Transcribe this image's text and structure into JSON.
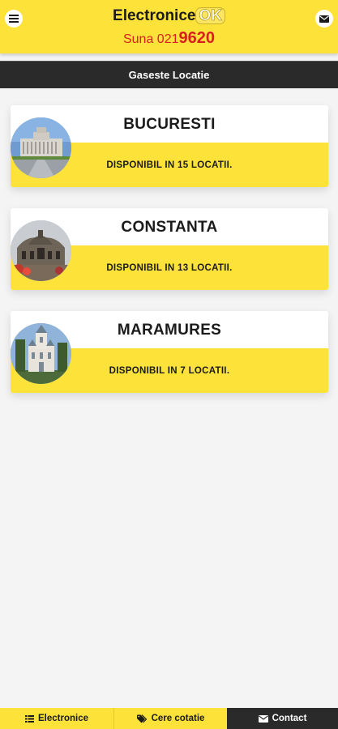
{
  "header": {
    "brand_name": "Electronice",
    "brand_ok": "OK",
    "phone_prefix": "Suna 021",
    "phone_bold": "9620",
    "menu_icon": "hamburger-icon",
    "mail_icon": "envelope-icon"
  },
  "section": {
    "title": "Gaseste Locatie"
  },
  "locations": [
    {
      "city": "BUCURESTI",
      "avail_prefix": "DISPONIBIL IN ",
      "avail_count": "15 LOCATII",
      "avail_suffix": "."
    },
    {
      "city": "CONSTANTA",
      "avail_prefix": "DISPONIBIL IN ",
      "avail_count": "13 LOCATII",
      "avail_suffix": "."
    },
    {
      "city": "MARAMURES",
      "avail_prefix": "DISPONIBIL IN ",
      "avail_count": "7 LOCATII",
      "avail_suffix": "."
    }
  ],
  "tabs": [
    {
      "label": "Electronice",
      "icon": "list-icon"
    },
    {
      "label": "Cere cotatie",
      "icon": "tags-icon"
    },
    {
      "label": "Contact",
      "icon": "envelope-icon"
    }
  ],
  "colors": {
    "brand_yellow": "#fde23a",
    "dark_bar": "#2a2a2a",
    "phone_red": "#d81f1f"
  }
}
